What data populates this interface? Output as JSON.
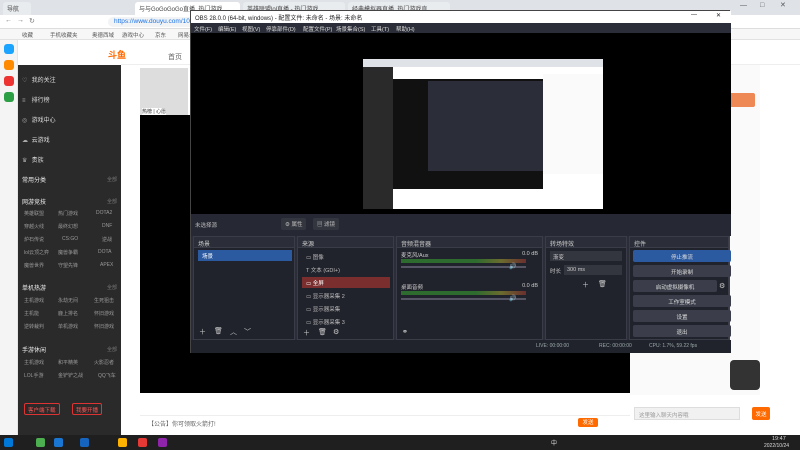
{
  "browser": {
    "tabs": [
      {
        "label": "导航"
      },
      {
        "label": "与与GoGoGoGo直播_热门游戏"
      },
      {
        "label": "英雄联盟lol直播 - 热门游戏"
      },
      {
        "label": "经典模拟器直播_热门游戏直"
      }
    ],
    "url": "https://www.douyu.com/10120",
    "bookmarks": [
      "收藏",
      "手机收藏夹",
      "奥德西域",
      "游戏中心",
      "京东",
      "网易云"
    ]
  },
  "douyu": {
    "logo": "斗鱼",
    "home": "首页",
    "sidebar": {
      "items": [
        {
          "icon": "heart-icon",
          "label": "我的关注"
        },
        {
          "icon": "list-icon",
          "label": "排行榜"
        },
        {
          "icon": "game-icon",
          "label": "游戏中心"
        },
        {
          "icon": "cloud-icon",
          "label": "云游戏"
        },
        {
          "icon": "crown-icon",
          "label": "贵族"
        }
      ],
      "section1": "常用分类",
      "section2": "网游竞技",
      "section3": "单机热游",
      "section4": "手游休闲",
      "more": "全部",
      "categories1": [
        "英雄联盟",
        "热门游戏",
        "DOTA2",
        "穿越火线",
        "最终幻想",
        "DNF",
        "炉石传说",
        "CS:GO",
        "逆战",
        "lol云顶之弈",
        "魔兽争霸",
        "DOTA",
        "魔兽世界",
        "守望先锋",
        "APEX"
      ],
      "categories2": [
        "主机游戏",
        "永劫无间",
        "生死狙击",
        "主机能",
        "鹿上排名",
        "怀旧游戏",
        "逆转裁判",
        "单机游戏",
        "怀旧游戏"
      ],
      "categories3": [
        "主机游戏",
        "和平精英",
        "火影忍者",
        "LOL手游",
        "金铲铲之战",
        "QQ飞车"
      ],
      "btn_app": "客户端下载",
      "btn_live": "我要开播"
    },
    "streamer_label": "热榜 | 心愿",
    "chat_placeholder": "【公告】你可领取火箭打!",
    "send_label": "发送",
    "right_input_placeholder": "这里输入聊天内容哦",
    "right_send_label": "发送"
  },
  "obs": {
    "title": "OBS 28.0.0 (64-bit, windows) - 配置文件: 未命名 - 场景: 未命名",
    "menu": [
      "文件(F)",
      "编辑(E)",
      "视图(V)",
      "停靠部件(D)",
      "配置文件(P)",
      "场景集合(S)",
      "工具(T)",
      "帮助(H)"
    ],
    "no_source": "未选择源",
    "props_btn": "属性",
    "filters_btn": "滤镜",
    "docks": {
      "scenes": {
        "title": "场景",
        "items": [
          "场景"
        ]
      },
      "sources": {
        "title": "来源",
        "items": [
          "图像",
          "文本 (GDI+)",
          "全屏",
          "显示器采集 2",
          "显示器采集",
          "显示器采集 3"
        ]
      },
      "mixer": {
        "title": "音频混音器",
        "ch1": {
          "name": "麦克风/Aux",
          "db": "0.0 dB"
        },
        "ch2": {
          "name": "桌面音频",
          "db": "0.0 dB"
        }
      },
      "transitions": {
        "title": "转场特效",
        "type": "渐变",
        "duration_label": "时长",
        "duration": "300 ms"
      },
      "controls": {
        "title": "控件",
        "buttons": [
          "停止推流",
          "开始录制",
          "启动虚拟摄像机",
          "工作室模式",
          "设置",
          "退出"
        ]
      }
    },
    "status": {
      "live": "LIVE: 00:00:00",
      "rec": "REC: 00:00:00",
      "cpu": "CPU: 1.7%, 59.22 fps"
    }
  },
  "taskbar": {
    "time": "19:47",
    "date": "2022/10/24",
    "lang": "中"
  }
}
